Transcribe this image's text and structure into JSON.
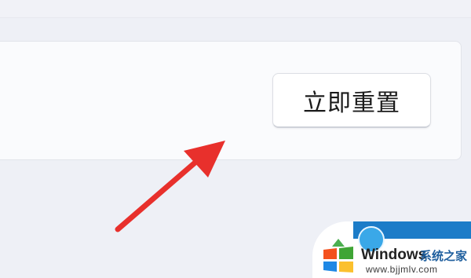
{
  "reset_button": {
    "label": "立即重置"
  },
  "annotation_arrow": {
    "color": "#e8302c"
  },
  "watermark": {
    "brand": "Windows",
    "site_name": "系统之家",
    "url": "www.bjjmlv.com",
    "logo_icon": "windows-flag-logo"
  }
}
